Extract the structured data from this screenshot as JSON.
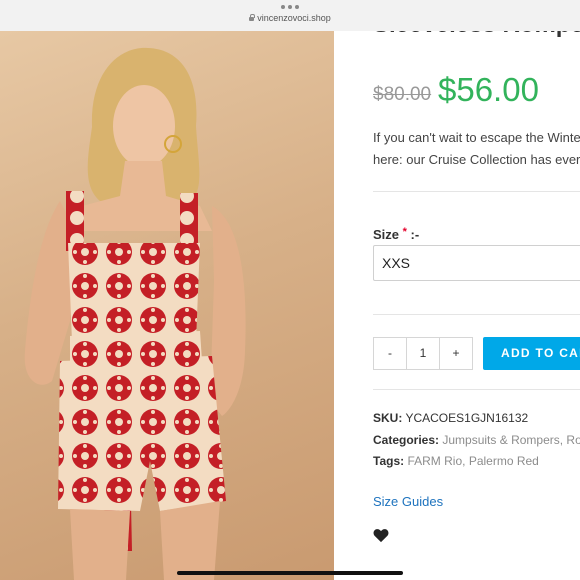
{
  "browser": {
    "url": "vincenzovoci.shop"
  },
  "product": {
    "title": "Sleeveless Romper",
    "old_price": "$80.00",
    "new_price": "$56.00",
    "description_lines": [
      "If you can't wait to escape the Winter",
      "here: our Cruise Collection has every"
    ],
    "size_label": "Size",
    "required_mark": "*",
    "size_suffix": ":-",
    "size_value": "XXS",
    "qty_minus": "-",
    "qty_value": "1",
    "qty_plus": "+",
    "add_to_cart": "ADD TO CART",
    "sku_label": "SKU:",
    "sku_value": "YCACOES1GJN16132",
    "categories_label": "Categories:",
    "categories": [
      "Jumpsuits & Rompers",
      "Ro"
    ],
    "tags_label": "Tags:",
    "tags": [
      "FARM Rio",
      "Palermo Red"
    ],
    "size_guides": "Size Guides",
    "wishlist_icon": "heart-icon"
  },
  "colors": {
    "sale_price": "#32b35b",
    "old_price": "#999999",
    "button": "#00a8e8",
    "link": "#1e73be",
    "romper_red": "#c41f26",
    "romper_cream": "#f3dcc2"
  }
}
